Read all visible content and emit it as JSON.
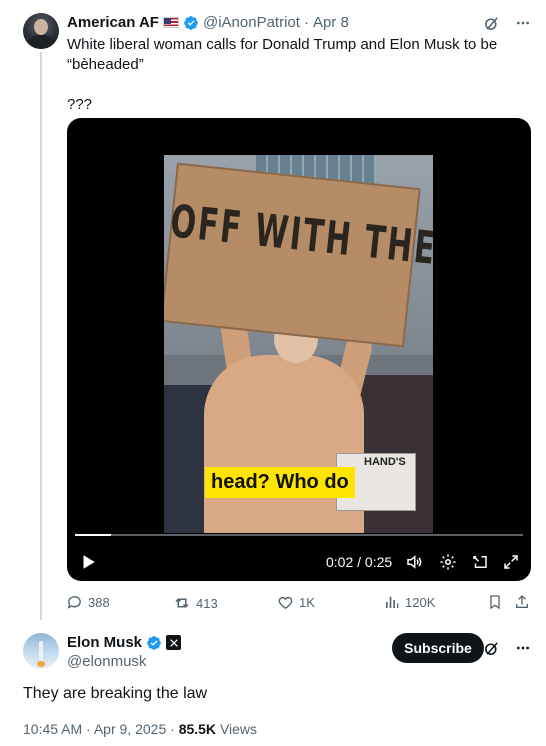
{
  "quoted_tweet": {
    "author_name": "American AF",
    "handle": "@iAnonPatriot",
    "separator": "·",
    "date": "Apr 8",
    "text_line1": "White liberal woman calls for Donald Trump and Elon Musk to be",
    "text_line2": "“bèheaded”",
    "text_line3": "???",
    "video": {
      "sign_text": "OFF WITH THEIR HEADS",
      "sign2_text": "HAND'S",
      "caption": "head? Who do",
      "time": "0:02 / 0:25",
      "progress": 0.08
    },
    "actions": {
      "replies": "388",
      "reposts": "413",
      "likes": "1K",
      "views": "120K"
    }
  },
  "reply": {
    "author_name": "Elon Musk",
    "handle": "@elonmusk",
    "subscribe_label": "Subscribe",
    "text": "They are breaking the law",
    "time": "10:45 AM",
    "separator": "·",
    "date": "Apr 9, 2025",
    "separator2": "·",
    "views_count": "85.5K",
    "views_label": "Views"
  },
  "icons": [
    "grok-icon",
    "more-icon",
    "verified-badge-icon",
    "us-flag-icon",
    "play-icon",
    "volume-icon",
    "settings-icon",
    "pip-icon",
    "fullscreen-icon",
    "reply-icon",
    "repost-icon",
    "like-icon",
    "views-icon",
    "bookmark-icon",
    "share-icon",
    "x-affiliation-icon"
  ],
  "colors": {
    "verified": "#1d9bf0",
    "muted": "#536471",
    "text": "#0f1419",
    "caption_bg": "#ffe600"
  }
}
